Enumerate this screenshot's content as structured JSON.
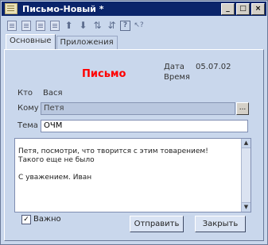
{
  "window": {
    "title": "Письмо-Новый *",
    "buttons": {
      "minimize": "_",
      "maximize": "□",
      "close": "×"
    }
  },
  "toolbar": {
    "icons": [
      "doc-icon",
      "doc-icon",
      "doc-icon",
      "doc-icon",
      "arrow-up-icon",
      "arrow-down-icon",
      "sort-asc-icon",
      "sort-desc-icon",
      "help-icon",
      "context-help-icon"
    ],
    "glyphs": {
      "up": "⬆",
      "down": "⬇",
      "sort_asc": "⇅",
      "sort_desc": "⇵",
      "help": "?",
      "context_help": "↖?"
    }
  },
  "tabs": [
    {
      "label": "Основные",
      "active": true
    },
    {
      "label": "Приложения",
      "active": false
    }
  ],
  "form": {
    "heading": "Письмо",
    "date_label": "Дата",
    "date_value": "05.07.02",
    "time_label": "Время",
    "from_label": "Кто",
    "from_value": "Вася",
    "to_label": "Кому",
    "to_value": "Петя",
    "to_lookup": "...",
    "subject_label": "Тема",
    "subject_value": "ОЧМ",
    "body_lines": [
      "Петя, посмотри, что творится с этим товарением!",
      "Такого еще не было",
      "",
      "С уважением. Иван"
    ],
    "important_label": "Важно",
    "important_checked": true,
    "check_mark": "✓",
    "send_button": "Отправить",
    "close_button": "Закрыть"
  },
  "scrollbar": {
    "up": "▲",
    "down": "▼"
  },
  "colors": {
    "title_bg": "#0a246a",
    "heading": "#ff0000",
    "panel_bg": "#c9d7ec"
  }
}
